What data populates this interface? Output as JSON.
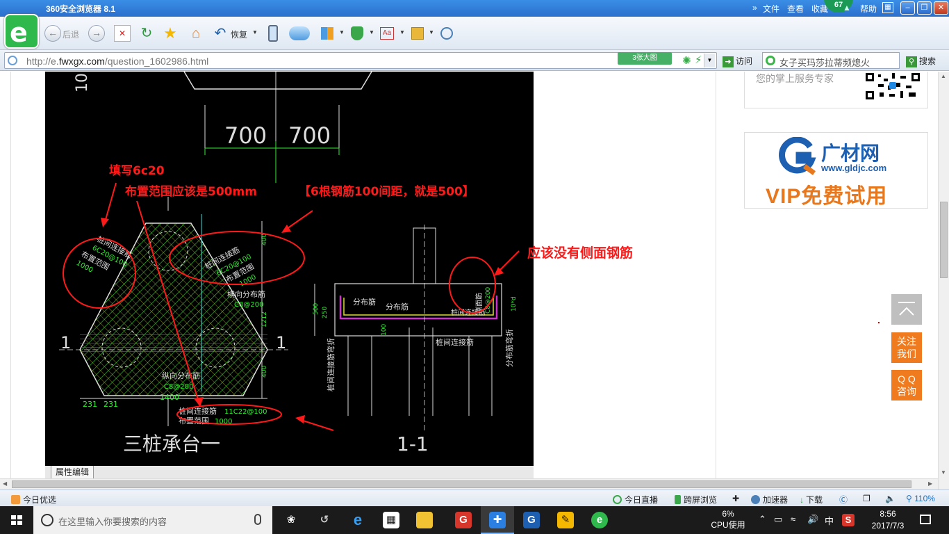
{
  "titlebar": {
    "title": "360安全浏览器 8.1",
    "menu": [
      "文件",
      "查看",
      "收藏",
      "帮助"
    ],
    "badge": "67",
    "chevrons": "»"
  },
  "toolbar": {
    "back_label": "后退",
    "restore_label": "恢复"
  },
  "addressbar": {
    "url_prefix": "http://e.",
    "url_domain": "fwxgx.com",
    "url_path": "/question_1602986.html",
    "bigimage_label": "3张大图",
    "visit_label": "访问",
    "search_value": "女子买玛莎拉蒂频熄火",
    "search_button": "搜索"
  },
  "cad": {
    "dims": [
      "700",
      "700",
      "231",
      "231",
      "1400",
      "400",
      "1212",
      "400",
      "500",
      "250",
      "100",
      "100"
    ],
    "section_markers": [
      "1",
      "1"
    ],
    "left_drawing": {
      "labels_pile_conn_left": [
        "桩间连接筋",
        "6C20@100",
        "布置范围",
        "1000"
      ],
      "labels_pile_conn_right": [
        "桩间连接筋",
        "6C20@100",
        "布置范围",
        "1000"
      ],
      "horiz_dist": [
        "横向分布筋",
        "C8@200"
      ],
      "long_dist": [
        "纵向分布筋",
        "C8@200"
      ],
      "bottom_conn": [
        "桩间连接筋",
        "11C22@100"
      ],
      "bottom_range": [
        "布置范围",
        "1000"
      ],
      "title": "三桩承台一"
    },
    "right_drawing": {
      "dist1": "分布筋",
      "dist2": "分布筋",
      "side_bar": "侧面筋",
      "side_spec": "C8@200",
      "conn": "桩间连接筋",
      "conn2": "桩间连接筋",
      "vert_left": "桩间连接筋弯折",
      "vert_right": "分布筋弯折",
      "ten_d": "10*d",
      "title": "1-1"
    },
    "annotations": {
      "fill_6c20": "填写6c20",
      "range_note": "布置范围应该是500mm",
      "range_bracket": "【6根钢筋100间距，就是500】",
      "no_side_bars": "应该没有侧面钢筋"
    }
  },
  "property_tab": "属性编辑",
  "ads": {
    "ad1_text": "您的掌上服务专家",
    "ad2_brand": "广材网",
    "ad2_site": "www.gldjc.com",
    "ad2_vip": "VIP免费试用"
  },
  "floating": {
    "follow": [
      "关注",
      "我们"
    ],
    "qq": [
      "Q Q",
      "咨询"
    ]
  },
  "statusbar": {
    "today_pick": "今日优选",
    "today_live": "今日直播",
    "cross_screen": "跨屏浏览",
    "accelerator": "加速器",
    "download": "下载",
    "zoom": "110%"
  },
  "taskbar": {
    "search_placeholder": "在这里输入你要搜索的内容",
    "cpu_percent": "6%",
    "cpu_label": "CPU使用",
    "ime": "中",
    "time": "8:56",
    "date": "2017/7/3"
  },
  "colors": {
    "annotation_red": "#ff1a1a",
    "cad_green": "#33ee33",
    "accent_orange": "#f07a1e",
    "title_blue": "#2a6fcc"
  }
}
